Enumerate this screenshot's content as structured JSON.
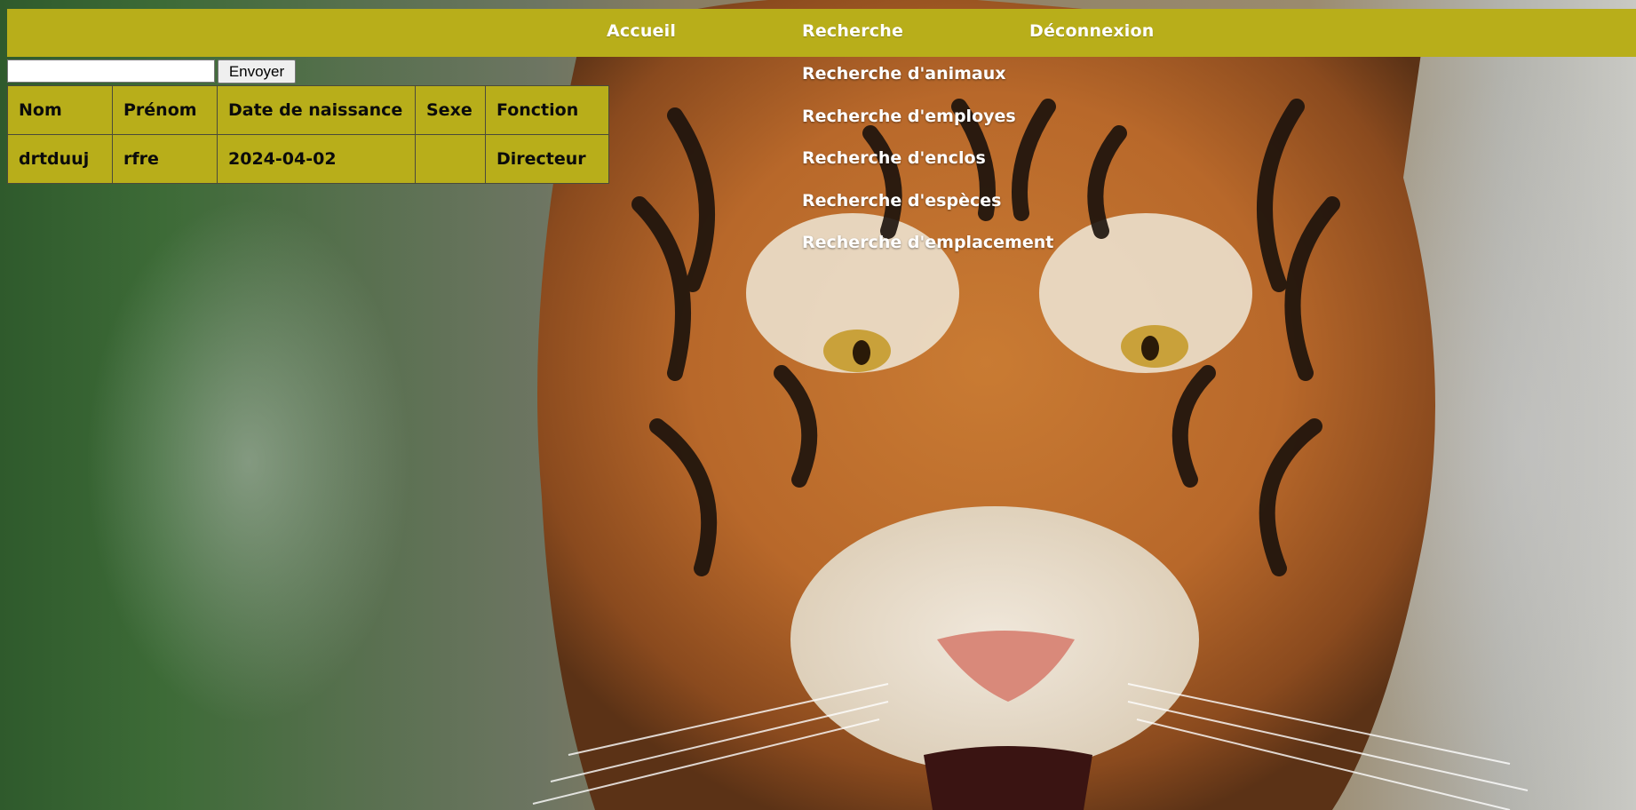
{
  "nav": {
    "accueil": "Accueil",
    "recherche": "Recherche",
    "deconnexion": "Déconnexion",
    "submenu": [
      "Recherche d'animaux",
      "Recherche d'employes",
      "Recherche d'enclos",
      "Recherche d'espèces",
      "Recherche d'emplacement"
    ]
  },
  "search": {
    "value": "",
    "button_label": "Envoyer"
  },
  "table": {
    "headers": [
      "Nom",
      "Prénom",
      "Date de naissance",
      "Sexe",
      "Fonction"
    ],
    "rows": [
      [
        "drtduuj",
        "rfre",
        "2024-04-02",
        "",
        "Directeur"
      ]
    ]
  },
  "colors": {
    "accent": "#b8ae1a",
    "nav_text": "#ffffff",
    "table_text": "#0b0b0b"
  },
  "background": {
    "image": "tiger-photo"
  }
}
